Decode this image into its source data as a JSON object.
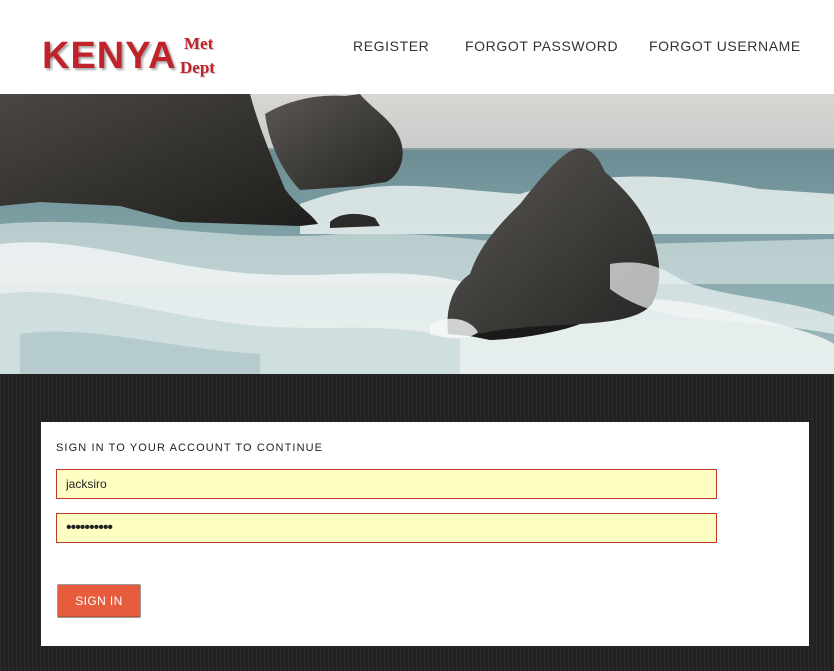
{
  "logo": {
    "main": "KENYA",
    "sub_line1": "Met",
    "sub_line2": "Dept"
  },
  "nav": {
    "register": "REGISTER",
    "forgot_password": "FORGOT PASSWORD",
    "forgot_username": "FORGOT USERNAME"
  },
  "login": {
    "title": "SIGN IN TO YOUR ACCOUNT TO CONTINUE",
    "username_value": "jacksiro",
    "password_value": "••••••••••",
    "submit_label": "SIGN IN"
  },
  "colors": {
    "brand_red": "#c0232a",
    "button_orange": "#e65c3c",
    "field_fill": "#ffffc4",
    "dark_band": "#222222"
  }
}
